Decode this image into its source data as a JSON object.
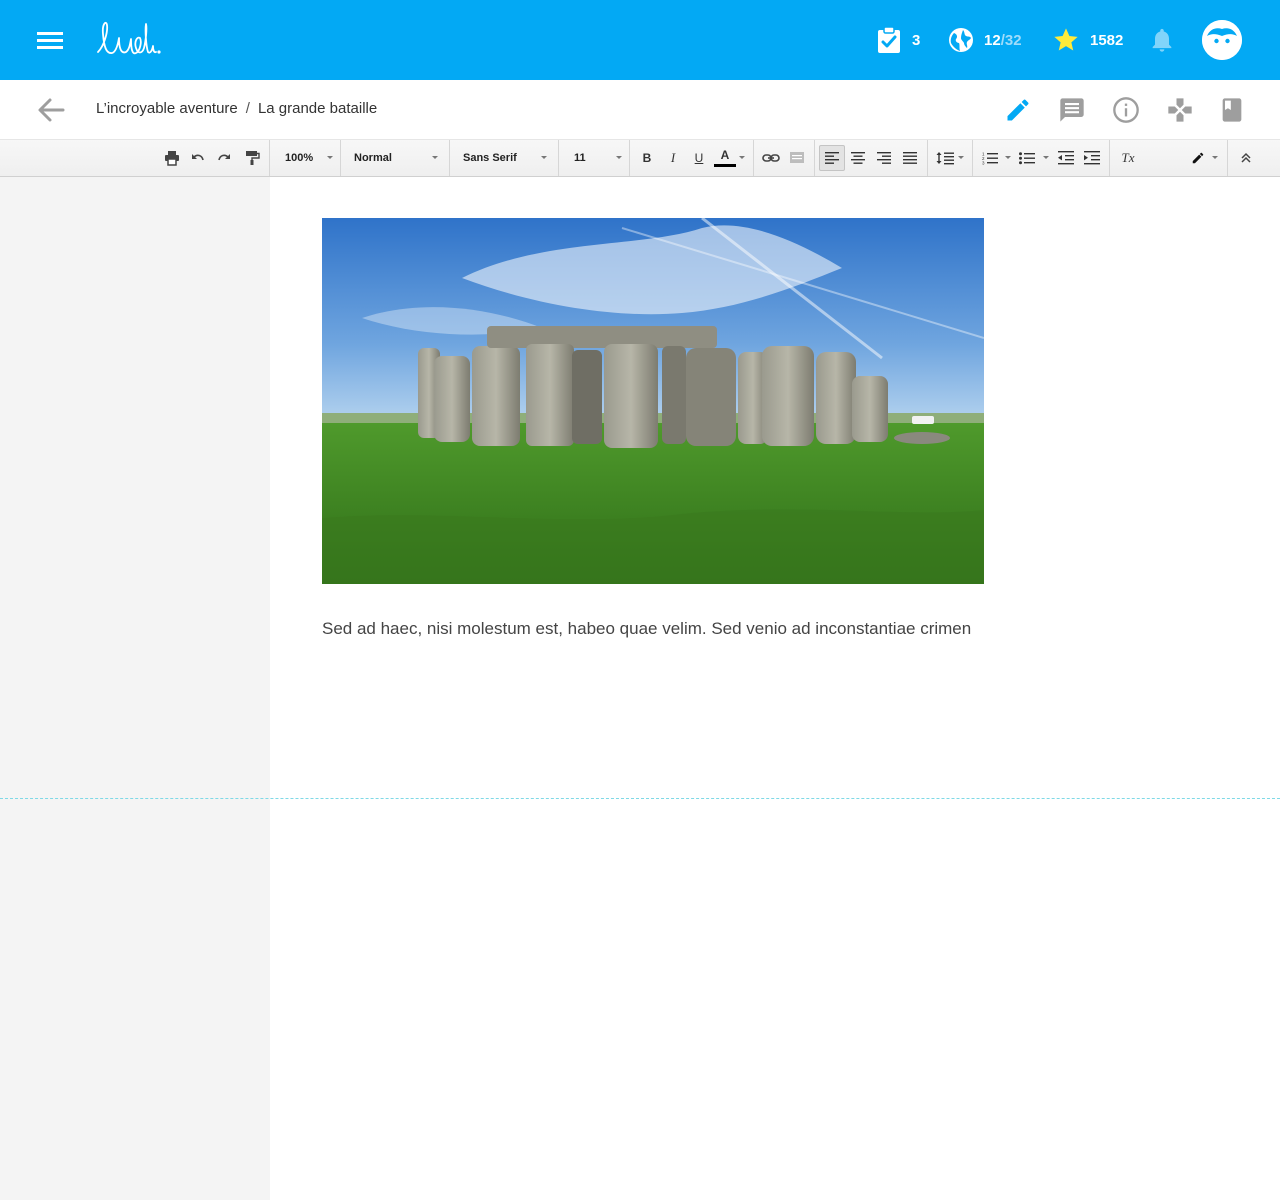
{
  "app": {
    "logo_text": "ludi."
  },
  "header": {
    "tasks_count": "3",
    "world_progress": "12",
    "world_total": "/32",
    "stars": "1582"
  },
  "breadcrumb": {
    "parent": "L’incroyable aventure",
    "separator": "/",
    "current": "La grande bataille"
  },
  "toolbar": {
    "zoom": "100%",
    "paragraph_style": "Normal",
    "font": "Sans Serif",
    "font_size": "11",
    "bold_label": "B",
    "italic_label": "I",
    "underline_label": "U",
    "text_color_label": "A",
    "clear_format_label": "Tx"
  },
  "document": {
    "image_alt": "Stonehenge",
    "paragraph": "Sed ad haec, nisi molestum est, habeo quae velim. Sed venio ad inconstantiae crimen"
  },
  "colors": {
    "brand": "#03a9f4",
    "active_tool": "#03a9f4",
    "star": "#ffeb3b",
    "icon_gray": "#9e9e9e"
  },
  "icons": {
    "menu": "hamburger-icon",
    "tasks": "clipboard-check-icon",
    "world": "globe-icon",
    "stars": "star-icon",
    "notifications": "bell-icon",
    "avatar": "avatar-face-icon",
    "back": "arrow-left-icon",
    "edit": "pencil-icon",
    "comments": "comment-icon",
    "info": "info-icon",
    "games": "gamepad-icon",
    "book": "book-icon"
  }
}
